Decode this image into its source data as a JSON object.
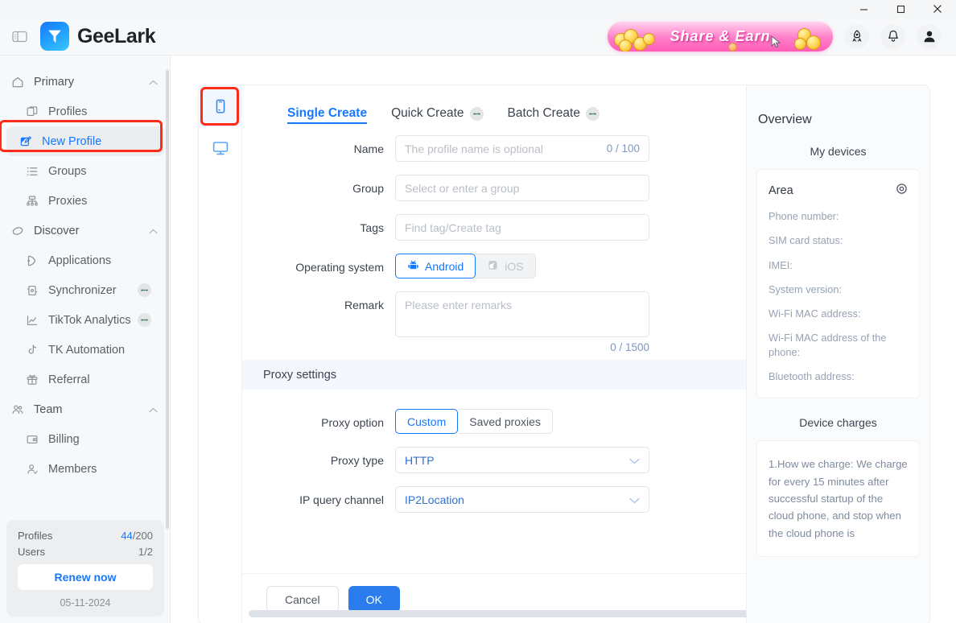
{
  "window": {
    "minimize_label": "minimize",
    "maximize_label": "maximize",
    "close_label": "close"
  },
  "header": {
    "brand": "GeeLark",
    "promo_text": "Share & Earn",
    "panel_toggle_name": "panel-toggle-icon",
    "rocket_name": "rocket-icon",
    "bell_name": "bell-icon",
    "avatar_name": "avatar-icon"
  },
  "sidebar": {
    "groups": [
      {
        "label": "Primary",
        "icon": "home-icon",
        "expanded": true,
        "items": [
          {
            "label": "Profiles",
            "icon": "profiles-icon",
            "active": false,
            "badge": false
          },
          {
            "label": "New Profile",
            "icon": "new-profile-icon",
            "active": true,
            "badge": false
          },
          {
            "label": "Groups",
            "icon": "groups-icon",
            "active": false,
            "badge": false
          },
          {
            "label": "Proxies",
            "icon": "proxies-icon",
            "active": false,
            "badge": false
          }
        ]
      },
      {
        "label": "Discover",
        "icon": "discover-icon",
        "expanded": true,
        "items": [
          {
            "label": "Applications",
            "icon": "applications-icon",
            "active": false,
            "badge": false
          },
          {
            "label": "Synchronizer",
            "icon": "synchronizer-icon",
            "active": false,
            "badge": true
          },
          {
            "label": "TikTok Analytics",
            "icon": "tiktok-analytics-icon",
            "active": false,
            "badge": true
          },
          {
            "label": "TK Automation",
            "icon": "tk-automation-icon",
            "active": false,
            "badge": false
          },
          {
            "label": "Referral",
            "icon": "referral-icon",
            "active": false,
            "badge": false
          }
        ]
      },
      {
        "label": "Team",
        "icon": "team-icon",
        "expanded": true,
        "items": [
          {
            "label": "Billing",
            "icon": "billing-icon",
            "active": false,
            "badge": false
          },
          {
            "label": "Members",
            "icon": "members-icon",
            "active": false,
            "badge": false
          }
        ]
      }
    ],
    "footer": {
      "profiles_label": "Profiles",
      "profiles_used": "44",
      "profiles_total": "/200",
      "users_label": "Users",
      "users_value": "1/2",
      "renew_label": "Renew now",
      "date": "05-11-2024"
    }
  },
  "rail": [
    {
      "name": "phone-device-icon",
      "selected": true
    },
    {
      "name": "desktop-device-icon",
      "selected": false
    }
  ],
  "tabs": [
    {
      "label": "Single Create",
      "active": true,
      "badge": false
    },
    {
      "label": "Quick Create",
      "active": false,
      "badge": true
    },
    {
      "label": "Batch Create",
      "active": false,
      "badge": true
    }
  ],
  "form": {
    "name": {
      "label": "Name",
      "placeholder": "The profile name is optional",
      "value": "",
      "counter": "0 / 100"
    },
    "group": {
      "label": "Group",
      "placeholder": "Select or enter a group",
      "value": ""
    },
    "tags": {
      "label": "Tags",
      "placeholder": "Find tag/Create tag",
      "value": ""
    },
    "operating_system": {
      "label": "Operating system",
      "options": [
        {
          "label": "Android",
          "state": "selected",
          "icon": "android-icon"
        },
        {
          "label": "iOS",
          "state": "disabled",
          "icon": "apple-icon"
        }
      ]
    },
    "remark": {
      "label": "Remark",
      "placeholder": "Please enter remarks",
      "value": "",
      "counter": "0 / 1500"
    }
  },
  "proxy_section": {
    "title": "Proxy settings",
    "collapse_icon": "chevron-up-icon",
    "proxy_option": {
      "label": "Proxy option",
      "options": [
        {
          "label": "Custom",
          "selected": true
        },
        {
          "label": "Saved proxies",
          "selected": false
        }
      ]
    },
    "proxy_type": {
      "label": "Proxy type",
      "value": "HTTP"
    },
    "ip_query_channel": {
      "label": "IP query channel",
      "value": "IP2Location"
    }
  },
  "footer_buttons": {
    "cancel": "Cancel",
    "ok": "OK"
  },
  "overview": {
    "title": "Overview",
    "devices_tab": "My devices",
    "area_label": "Area",
    "location_icon": "location-pin-icon",
    "fields": [
      "Phone number:",
      "SIM card status:",
      "IMEI:",
      "System version:",
      "Wi-Fi MAC address:",
      "Wi-Fi MAC address of the phone:",
      "Bluetooth address:"
    ],
    "charges_title": "Device charges",
    "charges_text": "1.How we charge: We charge for every 15 minutes after successful startup of the cloud phone, and stop when the cloud phone is"
  },
  "colors": {
    "accent": "#1677ff",
    "ok_button": "#2b7cec",
    "annotation": "#ff2b1a",
    "promo_pink": "#ff5cb8"
  }
}
